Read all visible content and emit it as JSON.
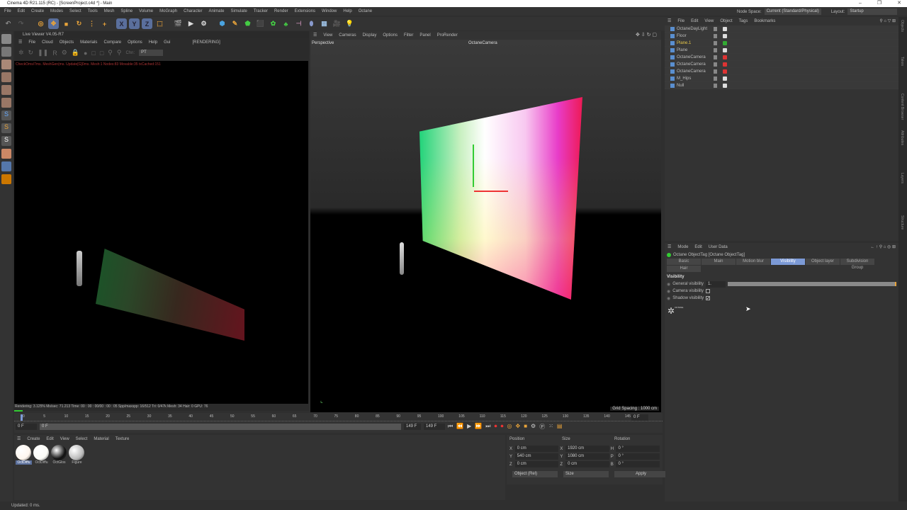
{
  "window": {
    "title": "Cinema 4D R21.115 (RC) - [ScreenProject.c4d *] - Main",
    "controls": [
      "–",
      "❐",
      "✕"
    ]
  },
  "menu": [
    "File",
    "Edit",
    "Create",
    "Modes",
    "Select",
    "Tools",
    "Mesh",
    "Spline",
    "Volume",
    "MoGraph",
    "Character",
    "Animate",
    "Simulate",
    "Tracker",
    "Render",
    "Extensions",
    "Window",
    "Help",
    "Octane"
  ],
  "header_right": {
    "node_space_label": "Node Space:",
    "node_space_value": "Current (Standard/Physical)",
    "layout_label": "Layout:",
    "layout_value": "Startup"
  },
  "toolbar": {
    "axis": [
      "X",
      "Y",
      "Z"
    ]
  },
  "live_viewer": {
    "title": "Live Viewer V4.05-R7",
    "menu": [
      "File",
      "Cloud",
      "Objects",
      "Materials",
      "Compare",
      "Options",
      "Help",
      "Gui"
    ],
    "state": "[RENDERING]",
    "channel_label": "Chn:",
    "channel_value": "PT",
    "log": "CheckOms/7ms. MeshGen(ms. Update[G]0ms. Mesh:1 Nodes:83 Movable:35 txCached:151",
    "status": "Rendering: 3.125%   Ms/sec: 71.213   Time: 00 : 00 : 00/00 : 00 : 05   Spp/maxspp: 16/512   Tri: 0/47k   Mesh: 34   Hair: 0   GPU: 76",
    "progress": 0.03
  },
  "viewport": {
    "menu": [
      "View",
      "Cameras",
      "Display",
      "Options",
      "Filter",
      "Panel",
      "ProRender"
    ],
    "label": "Perspective",
    "camera": "OctaneCamera",
    "grid": "Grid Spacing : 1000 cm"
  },
  "object_manager": {
    "menu": [
      "File",
      "Edit",
      "View",
      "Object",
      "Tags",
      "Bookmarks"
    ],
    "objects": [
      {
        "name": "OctaneDayLight",
        "selected": false
      },
      {
        "name": "Floor",
        "selected": false
      },
      {
        "name": "Plane.1",
        "selected": true
      },
      {
        "name": "Plane",
        "selected": false
      },
      {
        "name": "OctaneCamera",
        "selected": false
      },
      {
        "name": "OctaneCamera",
        "selected": false
      },
      {
        "name": "OctaneCamera",
        "selected": false
      },
      {
        "name": "M_Hips",
        "selected": false
      },
      {
        "name": "Null",
        "selected": false
      }
    ]
  },
  "side_tabs": [
    "Objects",
    "Takes",
    "Content Browser",
    "Attributes",
    "Layers",
    "Structure"
  ],
  "attributes": {
    "menu": [
      "Mode",
      "Edit",
      "User Data"
    ],
    "title": "Octane ObjectTag [Octane ObjectTag]",
    "tabs": [
      "Basic",
      "Main",
      "Motion blur",
      "Visibility",
      "Object layer",
      "Subdivision Group",
      "Hair"
    ],
    "active_tab": "Visibility",
    "section": "Visibility",
    "general_visibility_label": "General visibility",
    "general_visibility_value": "1.",
    "general_visibility_fraction": 1.0,
    "camera_visibility_label": "Camera visibility",
    "camera_visibility": false,
    "shadow_visibility_label": "Shadow visibility",
    "shadow_visibility": true,
    "logo_text": "OCTANE"
  },
  "timeline": {
    "ticks": [
      "0",
      "5",
      "10",
      "15",
      "20",
      "25",
      "30",
      "35",
      "40",
      "45",
      "50",
      "55",
      "60",
      "65",
      "70",
      "75",
      "80",
      "85",
      "90",
      "95",
      "100",
      "105",
      "110",
      "115",
      "120",
      "125",
      "130",
      "135",
      "140",
      "145"
    ],
    "current": "0 F",
    "start": "0 F",
    "end": "149 F",
    "end2": "149 F",
    "right_field": "0 F"
  },
  "materials": {
    "menu": [
      "Create",
      "Edit",
      "View",
      "Select",
      "Material",
      "Texture"
    ],
    "items": [
      {
        "name": "OctDiffu",
        "color": "#fff6ee"
      },
      {
        "name": "OctDiffu",
        "color": "#fbfbf6"
      },
      {
        "name": "OctGlos",
        "color": "#111111"
      },
      {
        "name": "Figure",
        "color": "#bbbbbb"
      }
    ]
  },
  "coordinates": {
    "headers": [
      "Position",
      "Size",
      "Rotation"
    ],
    "rows": [
      {
        "a": "X",
        "p": "0 cm",
        "b": "X",
        "s": "1920 cm",
        "c": "H",
        "r": "0 °"
      },
      {
        "a": "Y",
        "p": "540 cm",
        "b": "Y",
        "s": "1080 cm",
        "c": "P",
        "r": "0 °"
      },
      {
        "a": "Z",
        "p": "0 cm",
        "b": "Z",
        "s": "0 cm",
        "c": "B",
        "r": "0 °"
      }
    ],
    "mode": "Object (Rel)",
    "size_mode": "Size",
    "apply": "Apply"
  },
  "status": "Updated: 0 ms."
}
